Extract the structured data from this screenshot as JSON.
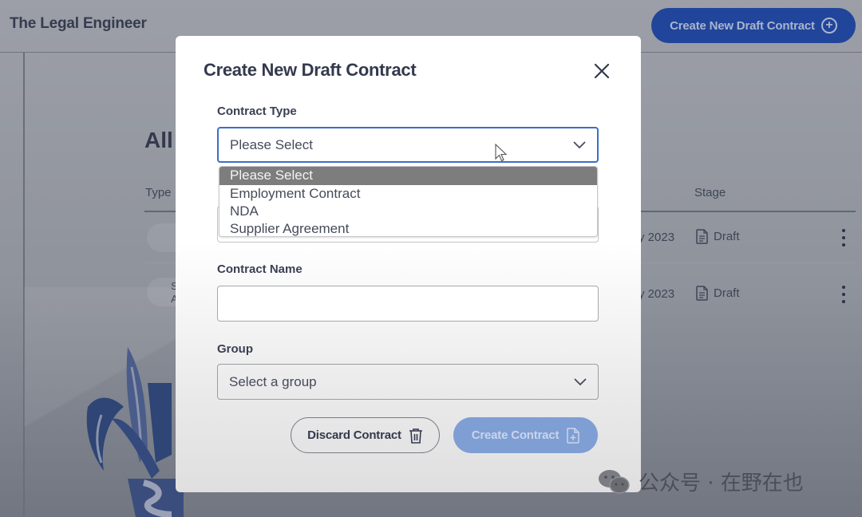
{
  "app": {
    "brand": "The Legal Engineer",
    "create_new_button": "Create New Draft Contract"
  },
  "background_page": {
    "heading_partial": "All",
    "columns": {
      "type": "Type",
      "stage": "Stage"
    },
    "rows": [
      {
        "type_partial": "",
        "date_partial": "y 2023",
        "stage": "Draft"
      },
      {
        "type_partial": "Su\nAg",
        "date_partial": "y 2023",
        "stage": "Draft"
      }
    ]
  },
  "modal": {
    "title": "Create New Draft Contract",
    "contract_type": {
      "label": "Contract Type",
      "value": "Please Select",
      "options": [
        "Please Select",
        "Employment Contract",
        "NDA",
        "Supplier Agreement"
      ],
      "highlighted_option": "Please Select"
    },
    "contract_name": {
      "label": "Contract Name",
      "value": ""
    },
    "group": {
      "label": "Group",
      "value": "Select a group"
    },
    "discard_button": "Discard Contract",
    "create_button": "Create Contract"
  },
  "watermark": {
    "text": "公众号 · 在野在也"
  },
  "colors": {
    "primary": "#21459a",
    "focus_border": "#3c6ec9",
    "create_disabled": "#7f9ed3",
    "overlay": "#9c9fa7"
  }
}
